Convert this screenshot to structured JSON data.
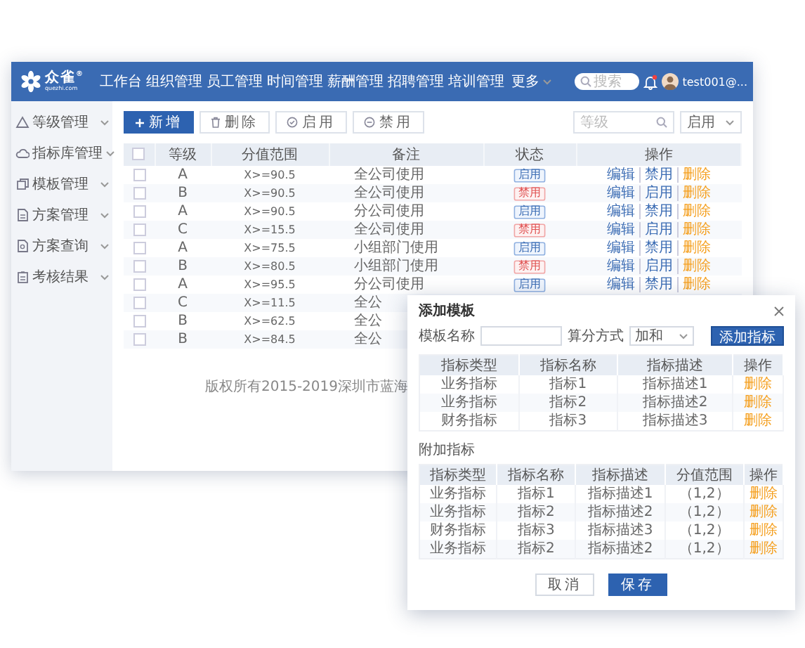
{
  "app": {
    "logo": {
      "name": "众雀",
      "mark": "®",
      "domain": "quezhi.com"
    },
    "nav": [
      "工作台",
      "组织管理",
      "员工管理",
      "时间管理",
      "薪酬管理",
      "招聘管理",
      "培训管理"
    ],
    "nav_more": "更多",
    "search": {
      "placeholder": "搜索"
    },
    "user": {
      "name": "test001@..."
    }
  },
  "sidebar": {
    "items": [
      "等级管理",
      "指标库管理",
      "模板管理",
      "方案管理",
      "方案查询",
      "考核结果"
    ]
  },
  "toolbar": {
    "buttons": [
      {
        "label": "新增",
        "kind": "add"
      },
      {
        "label": "删除",
        "kind": "delete"
      },
      {
        "label": "启用",
        "kind": "enable"
      },
      {
        "label": "禁用",
        "kind": "disable"
      }
    ],
    "search": {
      "placeholder": "等级"
    },
    "filter": {
      "value": "启用"
    }
  },
  "table": {
    "columns": [
      "等级",
      "分值范围",
      "备注",
      "状态",
      "操作"
    ],
    "header_checked": false,
    "rows": [
      {
        "checked": false,
        "grade": "A",
        "range": "X>=90.5",
        "remark": "全公司使用",
        "status": {
          "label": "启用",
          "enabled": true
        },
        "actions": [
          {
            "label": "编辑",
            "kind": "edit"
          },
          {
            "label": "禁用",
            "kind": "toggle"
          },
          {
            "label": "删除",
            "kind": "delete"
          }
        ]
      },
      {
        "checked": false,
        "grade": "B",
        "range": "X>=90.5",
        "remark": "全公司使用",
        "status": {
          "label": "禁用",
          "enabled": false
        },
        "actions": [
          {
            "label": "编辑",
            "kind": "edit"
          },
          {
            "label": "启用",
            "kind": "toggle"
          },
          {
            "label": "删除",
            "kind": "delete"
          }
        ]
      },
      {
        "checked": false,
        "grade": "A",
        "range": "X>=90.5",
        "remark": "分公司使用",
        "status": {
          "label": "启用",
          "enabled": true
        },
        "actions": [
          {
            "label": "编辑",
            "kind": "edit"
          },
          {
            "label": "禁用",
            "kind": "toggle"
          },
          {
            "label": "删除",
            "kind": "delete"
          }
        ]
      },
      {
        "checked": false,
        "grade": "C",
        "range": "X>=15.5",
        "remark": "全公司使用",
        "status": {
          "label": "禁用",
          "enabled": false
        },
        "actions": [
          {
            "label": "编辑",
            "kind": "edit"
          },
          {
            "label": "启用",
            "kind": "toggle"
          },
          {
            "label": "删除",
            "kind": "delete"
          }
        ]
      },
      {
        "checked": false,
        "grade": "A",
        "range": "X>=75.5",
        "remark": "小组部门使用",
        "status": {
          "label": "启用",
          "enabled": true
        },
        "actions": [
          {
            "label": "编辑",
            "kind": "edit"
          },
          {
            "label": "禁用",
            "kind": "toggle"
          },
          {
            "label": "删除",
            "kind": "delete"
          }
        ]
      },
      {
        "checked": false,
        "grade": "B",
        "range": "X>=80.5",
        "remark": "小组部门使用",
        "status": {
          "label": "禁用",
          "enabled": false
        },
        "actions": [
          {
            "label": "编辑",
            "kind": "edit"
          },
          {
            "label": "启用",
            "kind": "toggle"
          },
          {
            "label": "删除",
            "kind": "delete"
          }
        ]
      },
      {
        "checked": false,
        "grade": "A",
        "range": "X>=95.5",
        "remark": "分公司使用",
        "status": {
          "label": "启用",
          "enabled": true
        },
        "actions": [
          {
            "label": "编辑",
            "kind": "edit"
          },
          {
            "label": "禁用",
            "kind": "toggle"
          },
          {
            "label": "删除",
            "kind": "delete"
          }
        ]
      },
      {
        "checked": false,
        "grade": "C",
        "range": "X>=11.5",
        "remark": "全公"
      },
      {
        "checked": false,
        "grade": "B",
        "range": "X>=62.5",
        "remark": "全公"
      },
      {
        "checked": false,
        "grade": "B",
        "range": "X>=84.5",
        "remark": "全公"
      }
    ]
  },
  "footer": "版权所有2015-2019深圳市蓝海",
  "modal": {
    "title": "添加模板",
    "name_label": "模板名称",
    "method_label": "算分方式",
    "method_value": "加和",
    "add_button": "添加指标",
    "table": {
      "columns": [
        "指标类型",
        "指标名称",
        "指标描述",
        "操作"
      ],
      "rows": [
        {
          "type": "业务指标",
          "name": "指标1",
          "description": "指标描述1",
          "action": "删除"
        },
        {
          "type": "业务指标",
          "name": "指标2",
          "description": "指标描述2",
          "action": "删除"
        },
        {
          "type": "财务指标",
          "name": "指标3",
          "description": "指标描述3",
          "action": "删除"
        }
      ]
    },
    "extra_label": "附加指标",
    "extra_table": {
      "columns": [
        "指标类型",
        "指标名称",
        "指标描述",
        "分值范围",
        "操作"
      ],
      "rows": [
        {
          "type": "业务指标",
          "name": "指标1",
          "description": "指标描述1",
          "range": "（1,2）",
          "action": "删除"
        },
        {
          "type": "业务指标",
          "name": "指标2",
          "description": "指标描述2",
          "range": "（1,2）",
          "action": "删除"
        },
        {
          "type": "财务指标",
          "name": "指标3",
          "description": "指标描述3",
          "range": "（1,2）",
          "action": "删除"
        },
        {
          "type": "业务指标",
          "name": "指标2",
          "description": "指标描述2",
          "range": "（1,2）",
          "action": "删除"
        }
      ]
    },
    "buttons": [
      {
        "label": "取消",
        "kind": "secondary"
      },
      {
        "label": "保存",
        "kind": "primary"
      }
    ]
  }
}
